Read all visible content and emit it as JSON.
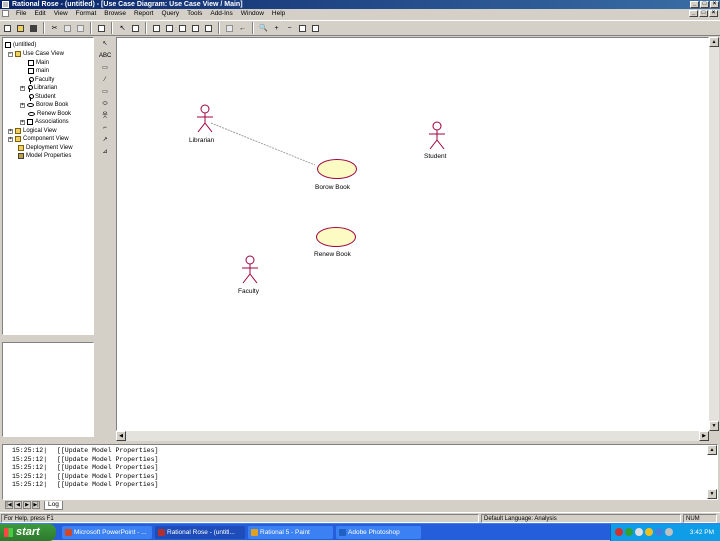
{
  "window": {
    "title": "Rational Rose - (untitled) - [Use Case Diagram: Use Case View / Main]"
  },
  "menu": [
    "File",
    "Edit",
    "View",
    "Format",
    "Browse",
    "Report",
    "Query",
    "Tools",
    "Add-Ins",
    "Window",
    "Help"
  ],
  "browser": {
    "items": [
      {
        "label": "(untitled)",
        "icon": "root-icon"
      },
      {
        "label": "Use Case View",
        "icon": "folder-icon"
      },
      {
        "label": "Main",
        "icon": "diagram-icon"
      },
      {
        "label": "main",
        "icon": "diagram-icon"
      },
      {
        "label": "Faculty",
        "icon": "actor-icon"
      },
      {
        "label": "Librarian",
        "icon": "actor-icon"
      },
      {
        "label": "Student",
        "icon": "actor-icon"
      },
      {
        "label": "Borow Book",
        "icon": "use-case-icon"
      },
      {
        "label": "Renew Book",
        "icon": "use-case-icon"
      },
      {
        "label": "Associations",
        "icon": "associations-icon"
      },
      {
        "label": "Logical View",
        "icon": "folder-icon"
      },
      {
        "label": "Component View",
        "icon": "folder-icon"
      },
      {
        "label": "Deployment View",
        "icon": "folder-icon"
      },
      {
        "label": "Model Properties",
        "icon": "properties-icon"
      }
    ]
  },
  "toolbox": [
    "select-tool",
    "text-tool",
    "note-tool",
    "anchor-tool",
    "package-tool",
    "use-case-tool",
    "actor-tool",
    "unidirectional-association-tool",
    "dependency-tool",
    "generalization-tool"
  ],
  "diagram": {
    "actors": [
      {
        "label": "Librarian"
      },
      {
        "label": "Student"
      },
      {
        "label": "Faculty"
      }
    ],
    "use_cases": [
      {
        "label": "Borow Book"
      },
      {
        "label": "Renew Book"
      }
    ]
  },
  "log": {
    "lines": [
      {
        "time": "15:25:12|",
        "text": "[[Update Model Properties]"
      },
      {
        "time": "15:25:12|",
        "text": "[[Update Model Properties]"
      },
      {
        "time": "15:25:12|",
        "text": "[[Update Model Properties]"
      },
      {
        "time": "15:25:12|",
        "text": "[[Update Model Properties]"
      },
      {
        "time": "15:25:12|",
        "text": "[[Update Model Properties]"
      }
    ],
    "tab": "Log"
  },
  "status": {
    "help": "For Help, press F1",
    "language": "Default Language: Analysis",
    "num": "NUM"
  },
  "taskbar": {
    "start": "start",
    "tasks": [
      {
        "label": "Microsoft PowerPoint - ...",
        "color": "#d24726"
      },
      {
        "label": "Rational Rose - (untitl...",
        "color": "#b03030"
      },
      {
        "label": "Rational 5 - Paint",
        "color": "#e0a020"
      },
      {
        "label": "Adobe Photoshop",
        "color": "#2060c0"
      }
    ],
    "clock": "3:42 PM"
  },
  "colors": {
    "actor_stroke": "#a00040",
    "use_case_fill": "#fdfbc4",
    "title_bar": "#0a246a",
    "taskbar": "#245edb"
  }
}
